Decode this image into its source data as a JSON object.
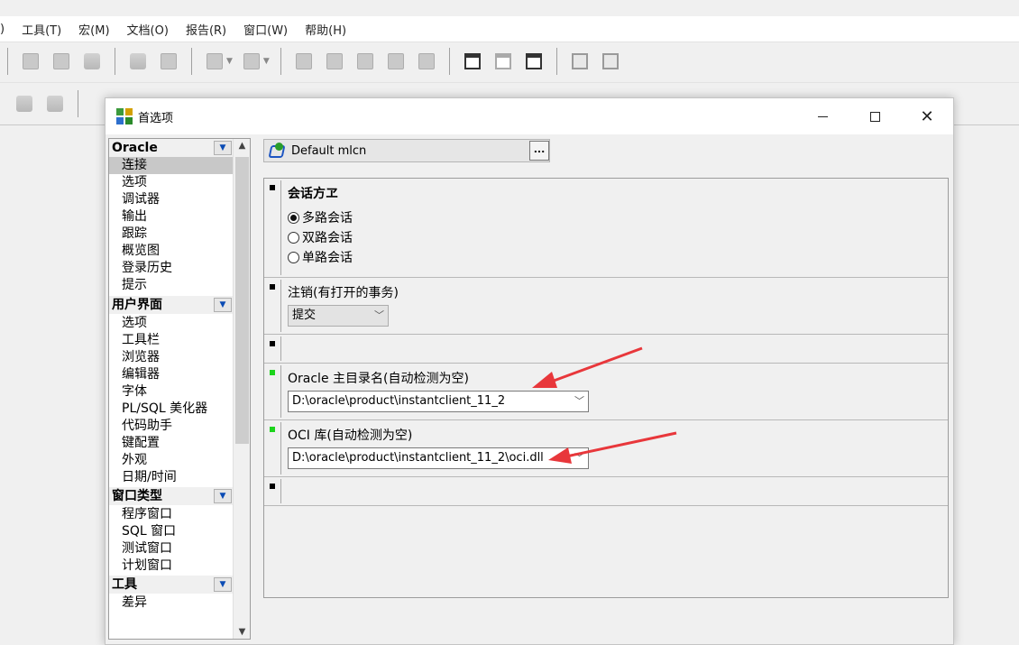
{
  "menu": [
    ")",
    "工具(T)",
    "宏(M)",
    "文档(O)",
    "报告(R)",
    "窗口(W)",
    "帮助(H)"
  ],
  "dialog": {
    "title": "首选项",
    "minimize_glyph": "—",
    "maximize_glyph": "☐",
    "close_glyph": "✕"
  },
  "categories": {
    "oracle": {
      "header": "Oracle",
      "items": [
        "连接",
        "选项",
        "调试器",
        "输出",
        "跟踪",
        "概览图",
        "登录历史",
        "提示"
      ]
    },
    "ui": {
      "header": "用户界面",
      "items": [
        "选项",
        "工具栏",
        "浏览器",
        "编辑器",
        "字体",
        "PL/SQL 美化器",
        "代码助手",
        "键配置",
        "外观",
        "日期/时间"
      ]
    },
    "window_types": {
      "header": "窗口类型",
      "items": [
        "程序窗口",
        "SQL 窗口",
        "测试窗口",
        "计划窗口"
      ]
    },
    "tools": {
      "header": "工具",
      "items": [
        "差异"
      ]
    }
  },
  "profile": {
    "value": "Default mlcn",
    "ellipsis": "..."
  },
  "settings": {
    "session_mode": {
      "title": "会话方ヱ",
      "options": [
        "多路会话",
        "双路会话",
        "单路会话"
      ],
      "selected": 0
    },
    "logoff": {
      "title": "注销(有打开的事务)",
      "value": "提交"
    },
    "oracle_home": {
      "title": "Oracle 主目录名(自动检测为空)",
      "value": "D:\\oracle\\product\\instantclient_11_2"
    },
    "oci_library": {
      "title": "OCI 库(自动检测为空)",
      "value": "D:\\oracle\\product\\instantclient_11_2\\oci.dll"
    }
  },
  "colors": {
    "annotation_arrow": "#e8373b",
    "active_marker": "#1cd41c"
  }
}
